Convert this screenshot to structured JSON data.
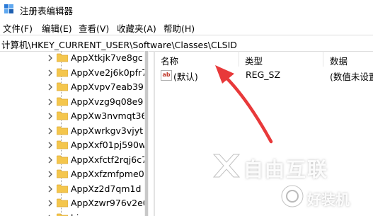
{
  "window": {
    "title": "注册表编辑器"
  },
  "menu": [
    {
      "label": "文件(F)"
    },
    {
      "label": "编辑(E)"
    },
    {
      "label": "查看(V)"
    },
    {
      "label": "收藏夹(A)"
    },
    {
      "label": "帮助(H)"
    }
  ],
  "address": {
    "path": "计算机\\HKEY_CURRENT_USER\\Software\\Classes\\CLSID"
  },
  "tree": {
    "items": [
      {
        "label": "AppXtkjk7ve8gc"
      },
      {
        "label": "AppXve2j6k0pfr7"
      },
      {
        "label": "AppXvpv7eab39"
      },
      {
        "label": "AppXvzg9q08e9"
      },
      {
        "label": "AppXw3nvmqt36"
      },
      {
        "label": "AppXwrkgv3vjyt"
      },
      {
        "label": "AppXxf01pj590w"
      },
      {
        "label": "AppXxfctf2rqj6c7"
      },
      {
        "label": "AppXxfzmfpme0"
      },
      {
        "label": "AppXz2d7qm1d"
      },
      {
        "label": "AppXzwr976v2e0"
      },
      {
        "label": "bingmaps"
      }
    ]
  },
  "list": {
    "columns": {
      "name": "名称",
      "type": "类型",
      "data": "数据"
    },
    "rows": [
      {
        "name": "(默认)",
        "type": "REG_SZ",
        "data": "(数值未设置"
      }
    ]
  },
  "watermark": {
    "line1": "自由互联",
    "line2": "好装机"
  },
  "colors": {
    "arrow": "#e8393a",
    "folder": "#f4c64d",
    "folder_dark": "#dca935"
  }
}
